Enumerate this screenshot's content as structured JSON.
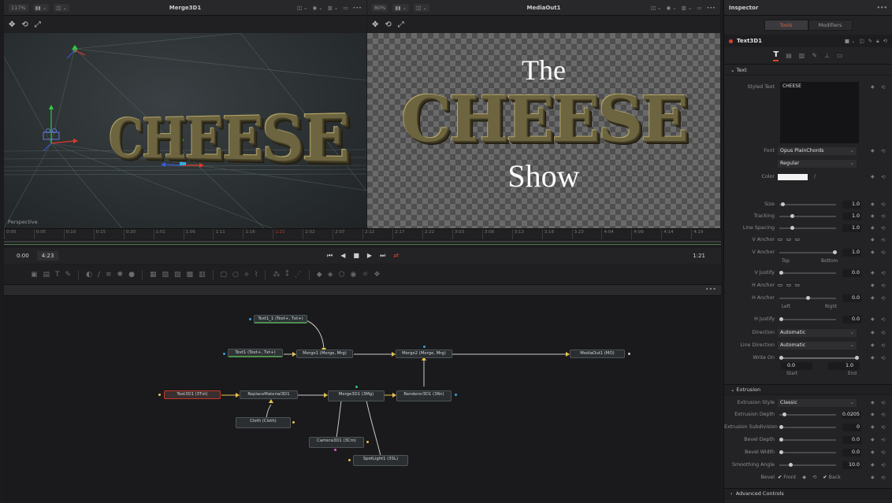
{
  "left_viewer": {
    "zoom": "117%",
    "title": "Merge3D1",
    "view_label": "Perspective",
    "text3d": "CHEESE"
  },
  "right_viewer": {
    "zoom": "80%",
    "title": "MediaOut1",
    "line1": "The",
    "line2": "CHEESE",
    "line3": "Show"
  },
  "ruler_ticks": [
    "0:00",
    "0:05",
    "0:10",
    "0:15",
    "0:20",
    "1:01",
    "1:06",
    "1:11",
    "1:16",
    "1:21",
    "2:02",
    "2:07",
    "2:12",
    "2:17",
    "2:22",
    "3:03",
    "3:08",
    "3:13",
    "3:18",
    "3:23",
    "4:04",
    "4:09",
    "4:14",
    "4:19"
  ],
  "transport": {
    "start": "0:00",
    "end": "4:23",
    "current": "1:21",
    "skip_back": "⏮",
    "step_back": "◀",
    "stop": "■",
    "play": "▶",
    "skip_fwd": "⏭",
    "loop": "⇄"
  },
  "nodes": {
    "text1_1": "Text1_1 (Text+, Txt+)",
    "text1": "Text1 (Text+, Txt+)",
    "merge1": "Merge1 (Merge, Mrg)",
    "merge2": "Merge2 (Merge, Mrg)",
    "mediaout1": "MediaOut1 (MO)",
    "text3d1": "Text3D1 (3Txt)",
    "replacematerial": "ReplaceMaterial3D1",
    "merge3d1": "Merge3D1 (3Mg)",
    "renderer3d1": "Renderer3D1 (3Rn)",
    "cloth": "Cloth (Cloth)",
    "camera3d1": "Camera3D1 (3Cm)",
    "spotlight1": "SpotLight1 (3SL)"
  },
  "inspector": {
    "title": "Inspector",
    "tabs": [
      "Tools",
      "Modifiers"
    ],
    "tool_name": "Text3D1",
    "subtab_active": "T",
    "section_text": "Text",
    "styled_text_label": "Styled Text",
    "styled_text_value": "CHEESE",
    "font_label": "Font",
    "font_value": "Opus PlainChords",
    "font_style": "Regular",
    "color_label": "Color",
    "size_label": "Size",
    "size_value": "1.0",
    "tracking_label": "Tracking",
    "tracking_value": "1.0",
    "line_spacing_label": "Line Spacing",
    "line_spacing_value": "1.0",
    "v_anchor_label": "V Anchor",
    "v_anchor_value": "1.0",
    "top_label": "Top",
    "bottom_label": "Bottom",
    "v_justify_label": "V Justify",
    "v_justify_value": "0.0",
    "h_anchor_label": "H Anchor",
    "h_anchor_value": "0.0",
    "left_label": "Left",
    "right_label": "Right",
    "h_justify_label": "H Justify",
    "h_justify_value": "0.0",
    "direction_label": "Direction",
    "direction_value": "Automatic",
    "line_direction_label": "Line Direction",
    "line_direction_value": "Automatic",
    "write_on_label": "Write On",
    "write_on_start": "0.0",
    "write_on_end": "1.0",
    "start_label": "Start",
    "end_label": "End",
    "section_extrusion": "Extrusion",
    "extrusion_style_label": "Extrusion Style",
    "extrusion_style_value": "Classic",
    "extrusion_depth_label": "Extrusion Depth",
    "extrusion_depth_value": "0.0205",
    "extrusion_subdiv_label": "Extrusion Subdivisions",
    "extrusion_subdiv_value": "0",
    "bevel_depth_label": "Bevel Depth",
    "bevel_depth_value": "0.0",
    "bevel_width_label": "Bevel Width",
    "bevel_width_value": "0.0",
    "smoothing_label": "Smoothing Angle",
    "smoothing_value": "10.0",
    "bevel_label": "Bevel",
    "front_label": "Front",
    "back_label": "Back",
    "section_advanced": "Advanced Controls"
  },
  "colors": {
    "accent": "#d9412a",
    "panel": "#232325",
    "node_border": "#4c5357"
  }
}
